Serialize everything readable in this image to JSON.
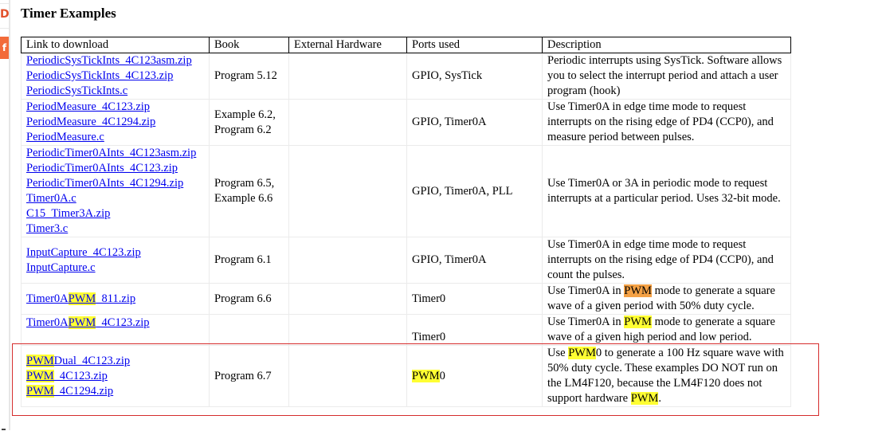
{
  "page": {
    "title": "Timer Examples"
  },
  "side_icons": {
    "top_glyph": "D",
    "second_glyph": "f"
  },
  "table": {
    "headers": [
      "Link to download",
      "Book",
      "External Hardware",
      "Ports used",
      "Description"
    ],
    "rows": [
      {
        "links": [
          "PeriodicSysTickInts_4C123asm.zip",
          "PeriodicSysTickInts_4C123.zip",
          "PeriodicSysTickInts.c"
        ],
        "book": "Program 5.12",
        "hardware": "",
        "ports": "GPIO, SysTick",
        "description": "Periodic interrupts using SysTick. Software allows you to select the interrupt period and attach a user program (hook)"
      },
      {
        "links": [
          "PeriodMeasure_4C123.zip",
          "PeriodMeasure_4C1294.zip",
          "PeriodMeasure.c"
        ],
        "book_line1": "Example 6.2,",
        "book_line2": "Program 6.2",
        "hardware": "",
        "ports": "GPIO, Timer0A",
        "description": "Use Timer0A in edge time mode to request interrupts on the rising edge of PD4 (CCP0), and measure period between pulses."
      },
      {
        "links": [
          "PeriodicTimer0AInts_4C123asm.zip",
          "PeriodicTimer0AInts_4C123.zip",
          "PeriodicTimer0AInts_4C1294.zip",
          "Timer0A.c",
          "C15_Timer3A.zip",
          "Timer3.c"
        ],
        "book_line1": "Program 6.5,",
        "book_line2": "Example 6.6",
        "hardware": "",
        "ports": "GPIO, Timer0A, PLL",
        "description": "Use Timer0A or 3A in periodic mode to request interrupts at a particular period. Uses 32-bit mode."
      },
      {
        "links": [
          "InputCapture_4C123.zip",
          "InputCapture.c"
        ],
        "book": "Program 6.1",
        "hardware": "",
        "ports": "GPIO, Timer0A",
        "description": "Use Timer0A in edge time mode to request interrupts on the rising edge of PD4 (CCP0), and count the pulses."
      },
      {
        "link_pre": "Timer0A",
        "link_hl": "PWM",
        "link_post": "_811.zip",
        "book": "Program 6.6",
        "hardware": "",
        "ports": "Timer0",
        "desc_pre": "Use Timer0A in ",
        "desc_hl": "PWM",
        "desc_post": " mode to generate a square wave of a given period with 50% duty cycle."
      },
      {
        "link_pre": "Timer0A",
        "link_hl": "PWM",
        "link_post": "_4C123.zip",
        "book": "",
        "hardware": "",
        "ports": "Timer0",
        "desc_pre": "Use Timer0A in ",
        "desc_hl": "PWM",
        "desc_post": " mode to generate a square wave of a given high period and low period."
      },
      {
        "links": [
          {
            "hl": "PWM",
            "post": "Dual_4C123.zip"
          },
          {
            "hl": "PWM",
            "post": "_4C123.zip"
          },
          {
            "hl": "PWM",
            "post": "_4C1294.zip"
          }
        ],
        "book": "Program 6.7",
        "hardware": "",
        "ports_hl": "PWM",
        "ports_post": "0",
        "desc_a": "Use ",
        "desc_hl1": "PWM",
        "desc_b": "0 to generate a 100 Hz square wave with 50% duty cycle. These examples DO NOT run on the LM4F120, because the LM4F120 does not support hardware ",
        "desc_hl2": "PWM",
        "desc_c": "."
      }
    ]
  },
  "colors": {
    "link": "#0000ee",
    "search_highlight": "#ffff33",
    "current_match_highlight": "#f4a145",
    "selection_box": "#d52c2c"
  }
}
